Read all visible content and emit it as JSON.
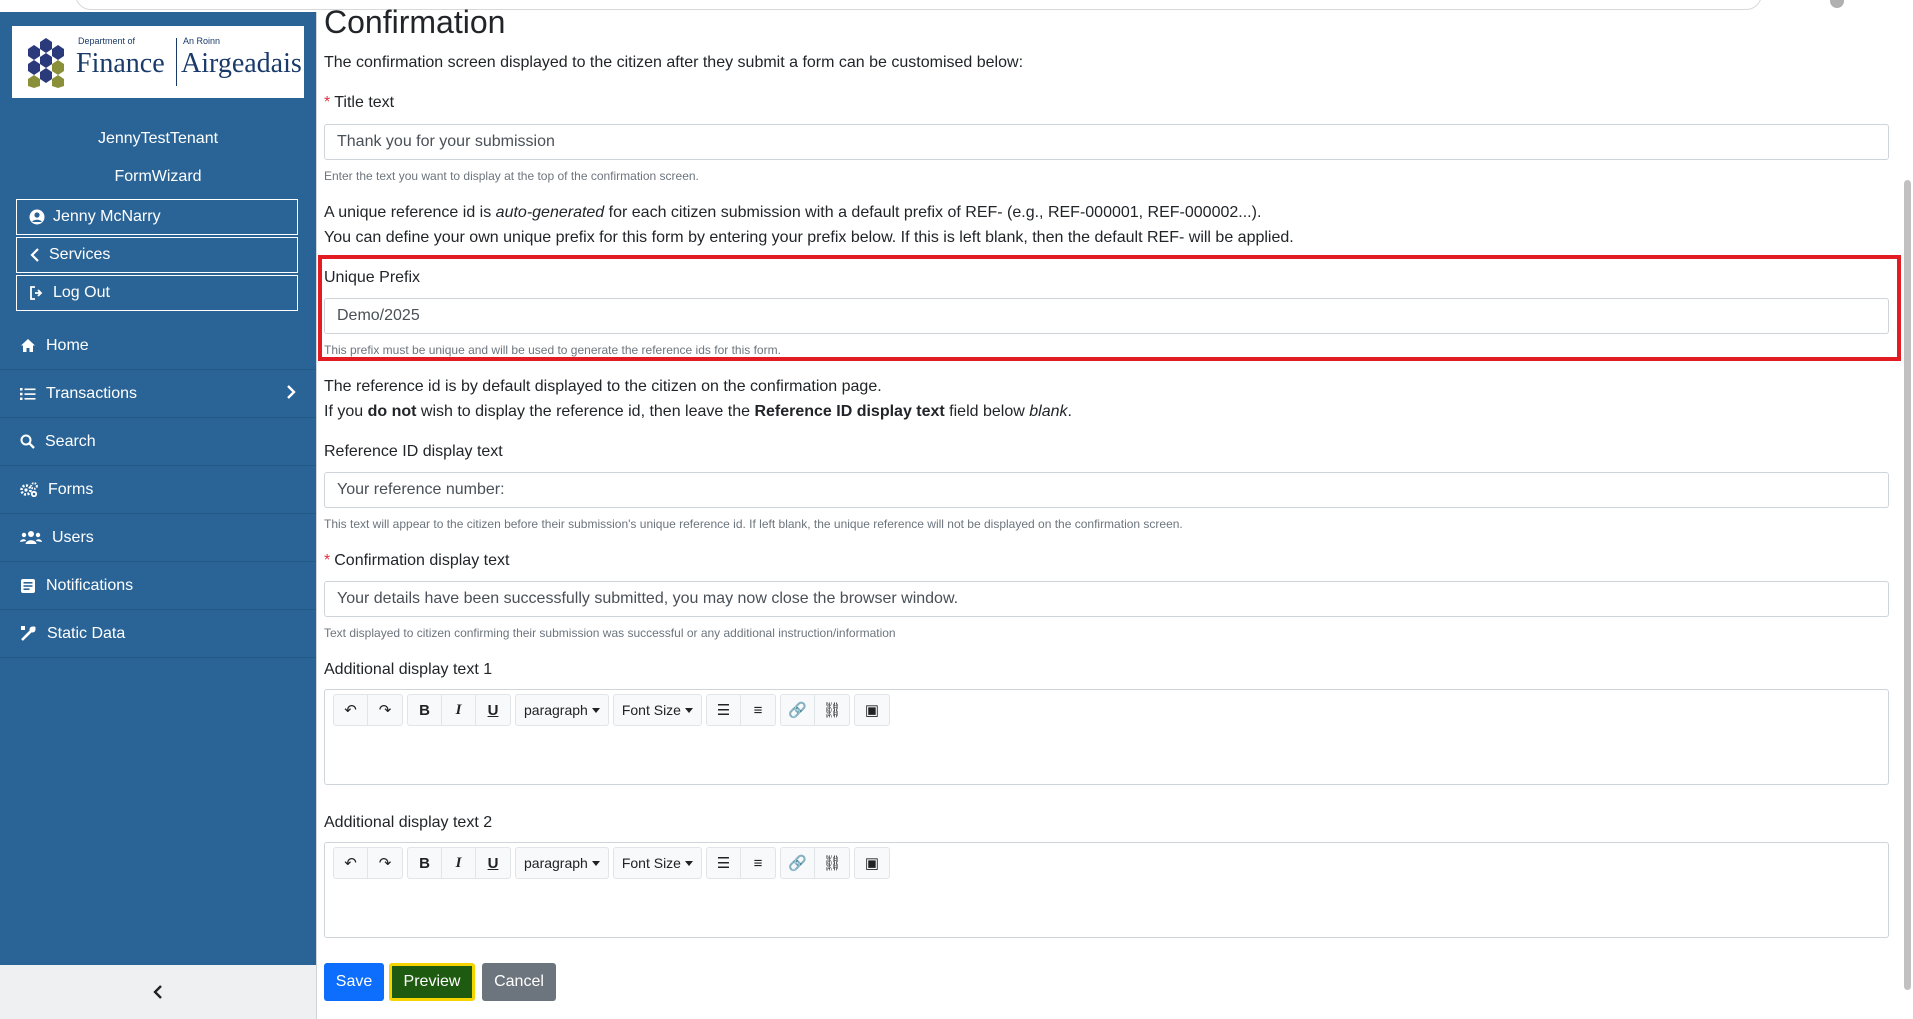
{
  "sidebar": {
    "logo": {
      "dept_line": "Department of",
      "dept_name": "Finance",
      "irish_line": "An Roinn",
      "irish_name": "Airgeadais"
    },
    "tenant": "JennyTestTenant",
    "app": "FormWizard",
    "user": "Jenny McNarry",
    "services": "Services",
    "logout": "Log Out",
    "nav": [
      {
        "label": "Home",
        "icon": "home-icon"
      },
      {
        "label": "Transactions",
        "icon": "list-icon"
      },
      {
        "label": "Search",
        "icon": "search-icon"
      },
      {
        "label": "Forms",
        "icon": "cogs-icon"
      },
      {
        "label": "Users",
        "icon": "users-icon"
      },
      {
        "label": "Notifications",
        "icon": "envelope-icon"
      },
      {
        "label": "Static Data",
        "icon": "tools-icon"
      }
    ]
  },
  "main": {
    "title": "Confirmation",
    "intro": "The confirmation screen displayed to the citizen after they submit a form can be customised below:",
    "title_text": {
      "label": "Title text",
      "value": "Thank you for your submission",
      "help": "Enter the text you want to display at the top of the confirmation screen."
    },
    "ref_info": {
      "line1_a": "A unique reference id is ",
      "line1_b": "auto-generated",
      "line1_c": " for each citizen submission with a default prefix of REF- (e.g., REF-000001, REF-000002...).",
      "line2": "You can define your own unique prefix for this form by entering your prefix below. If this is left blank, then the default REF- will be applied."
    },
    "unique_prefix": {
      "label": "Unique Prefix",
      "value": "Demo/2025",
      "help": "This prefix must be unique and will be used to generate the reference ids for this form."
    },
    "ref_display_info": {
      "line1": "The reference id is by default displayed to the citizen on the confirmation page.",
      "line2_a": "If you ",
      "line2_b": "do not",
      "line2_c": " wish to display the reference id, then leave the ",
      "line2_d": "Reference ID display text",
      "line2_e": " field below ",
      "line2_f": "blank",
      "line2_g": "."
    },
    "ref_display_text": {
      "label": "Reference ID display text",
      "value": "Your reference number:",
      "help": "This text will appear to the citizen before their submission's unique reference id. If left blank, the unique reference will not be displayed on the confirmation screen."
    },
    "confirmation_text": {
      "label": "Confirmation display text",
      "value": "Your details have been successfully submitted, you may now close the browser window.",
      "help": "Text displayed to citizen confirming their submission was successful or any additional instruction/information"
    },
    "additional1": {
      "label": "Additional display text 1"
    },
    "additional2": {
      "label": "Additional display text 2"
    },
    "editor": {
      "paragraph": "paragraph",
      "font_size": "Font Size"
    },
    "required_mark": "*",
    "buttons": {
      "save": "Save",
      "preview": "Preview",
      "cancel": "Cancel"
    },
    "colors": {
      "sidebar": "#2a6496",
      "save": "#0d6efd",
      "preview": "#1e5a0f",
      "preview_border": "#f5d400",
      "cancel": "#6c757d",
      "highlight": "#e31b23"
    }
  }
}
